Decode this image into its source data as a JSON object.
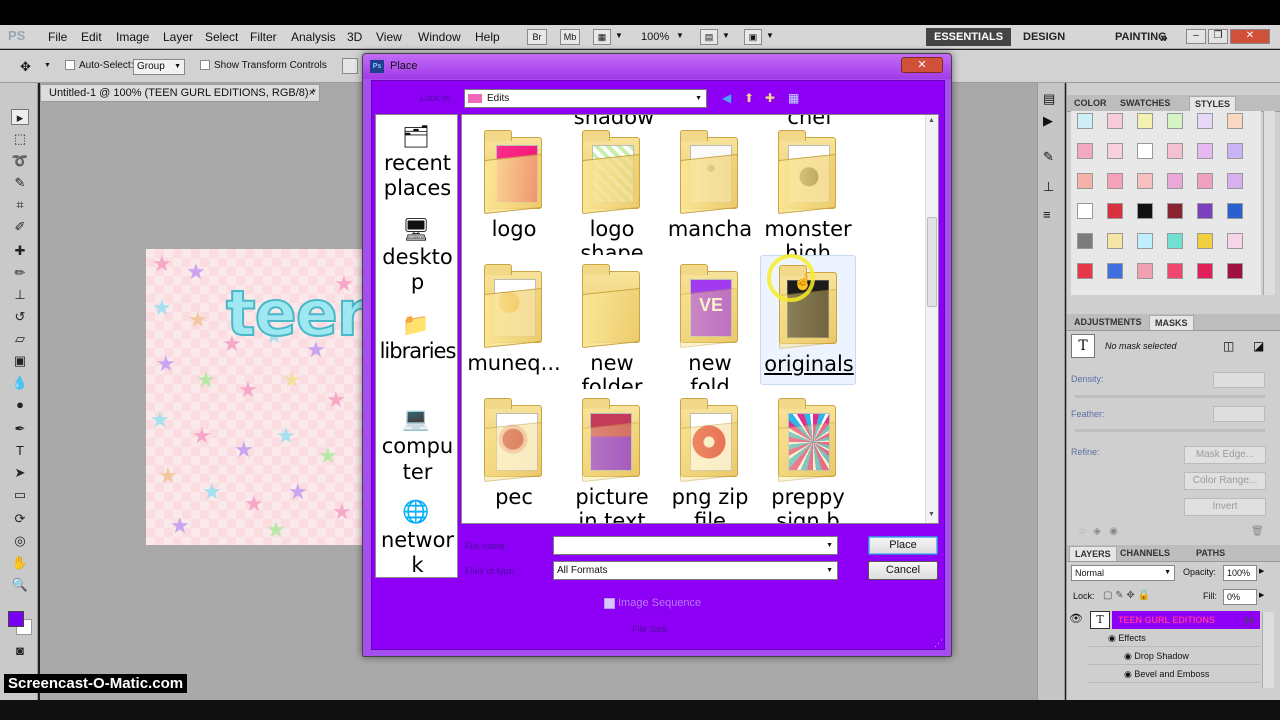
{
  "app": {
    "logo": "PS"
  },
  "menu": [
    "File",
    "Edit",
    "Image",
    "Layer",
    "Select",
    "Filter",
    "Analysis",
    "3D",
    "View",
    "Window",
    "Help"
  ],
  "menubar_controls": {
    "br": "Br",
    "mb": "Mb",
    "zoom": "100%"
  },
  "workspaces": {
    "active": "ESSENTIALS",
    "items": [
      "DESIGN",
      "PAINTING"
    ],
    "more": "»"
  },
  "options": {
    "auto_select_label": "Auto-Select:",
    "auto_select_value": "Group",
    "transform_label": "Show Transform Controls"
  },
  "document": {
    "tab_title": "Untitled-1 @ 100% (TEEN GURL EDITIONS, RGB/8) *",
    "close": "×",
    "canvas_text": "teer"
  },
  "colors": {
    "foreground": "#7a00f5",
    "background": "#ffffff",
    "dialog_body": "#8d00f5",
    "dialog_frame": "#a64ff0"
  },
  "panels": {
    "color_tabs": [
      "COLOR",
      "SWATCHES",
      "STYLES"
    ],
    "adjust_tabs": [
      "ADJUSTMENTS",
      "MASKS"
    ],
    "mask_status": "No mask selected",
    "density_label": "Density:",
    "feather_label": "Feather:",
    "refine_label": "Refine:",
    "mask_edge_btn": "Mask Edge...",
    "color_range_btn": "Color Range...",
    "invert_btn": "Invert",
    "layers_tabs": [
      "LAYERS",
      "CHANNELS",
      "PATHS"
    ],
    "blend_mode": "Normal",
    "opacity_label": "Opacity:",
    "opacity_value": "100%",
    "lock_label": "Lock:",
    "fill_label": "Fill:",
    "fill_value": "0%",
    "layer_name": "TEEN GURL EDITIONS",
    "effects_label": "Effects",
    "effects": [
      "Drop Shadow",
      "Bevel and Emboss"
    ]
  },
  "dialog": {
    "title": "Place",
    "look_in_label": "Look in:",
    "look_in_value": "Edits",
    "places": [
      {
        "icon": "recent-places-icon",
        "label1": "recent",
        "label2": "places"
      },
      {
        "icon": "desktop-icon",
        "label1": "deskto",
        "label2": "p"
      },
      {
        "icon": "libraries-icon",
        "label1": "libraries",
        "label2": ""
      },
      {
        "icon": "computer-icon",
        "label1": "compu",
        "label2": "ter"
      },
      {
        "icon": "network-icon",
        "label1": "networ",
        "label2": "k"
      }
    ],
    "partial_labels": [
      "shadow",
      "chef"
    ],
    "folders": [
      {
        "line1": "logo",
        "line2": ""
      },
      {
        "line1": "logo",
        "line2": "shape"
      },
      {
        "line1": "mancha",
        "line2": ""
      },
      {
        "line1": "monster",
        "line2": "high"
      },
      {
        "line1": "muneq...",
        "line2": ""
      },
      {
        "line1": "new",
        "line2": "folder"
      },
      {
        "line1": "new",
        "line2": "fold"
      },
      {
        "line1": "originals",
        "line2": ""
      },
      {
        "line1": "pec",
        "line2": ""
      },
      {
        "line1": "picture",
        "line2": "in text"
      },
      {
        "line1": "png zip",
        "line2": "file"
      },
      {
        "line1": "preppy",
        "line2": "sign b"
      }
    ],
    "folder_thumb_text": "VE",
    "file_name_label": "File name:",
    "file_name_value": "",
    "files_of_type_label": "Files of type:",
    "files_of_type_value": "All Formats",
    "place_button": "Place",
    "cancel_button": "Cancel",
    "image_sequence_label": "Image Sequence",
    "file_size_label": "File Size:"
  },
  "watermark": "Screencast-O-Matic.com"
}
